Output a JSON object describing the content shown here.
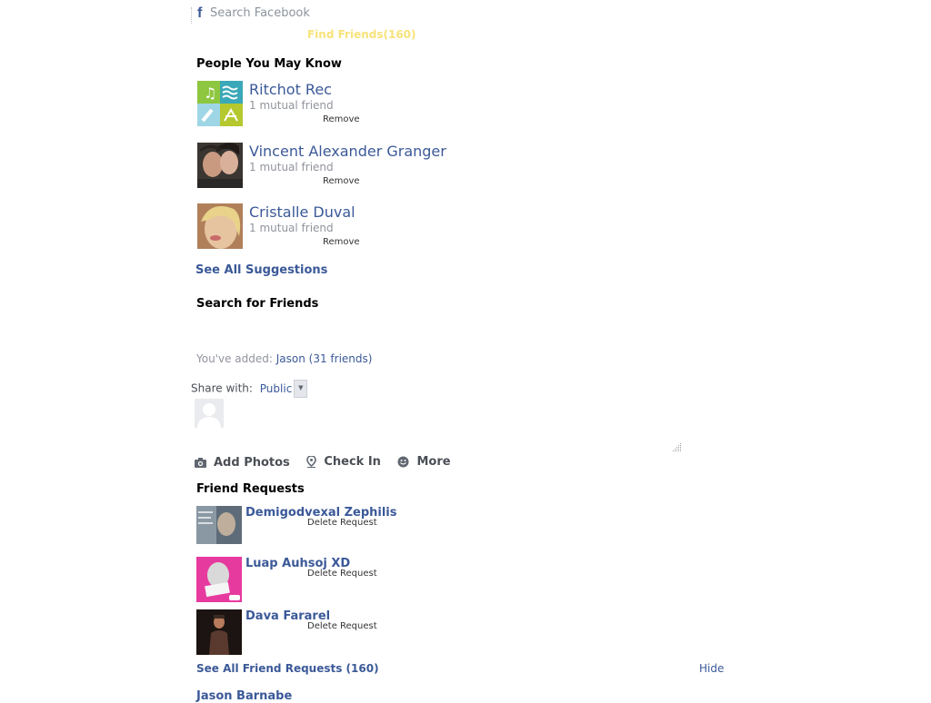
{
  "search": {
    "placeholder": "Search Facebook",
    "logo_icon": "facebook-f-icon"
  },
  "find_friends": {
    "label": "Find Friends",
    "count": "(160)"
  },
  "people_you_may_know": {
    "title": "People You May Know",
    "items": [
      {
        "name": "Ritchot Rec",
        "mutual": "1 mutual friend",
        "remove_label": "Remove"
      },
      {
        "name": "Vincent Alexander Granger",
        "mutual": "1 mutual friend",
        "remove_label": "Remove"
      },
      {
        "name": "Cristalle Duval",
        "mutual": "1 mutual friend",
        "remove_label": "Remove"
      }
    ],
    "see_all_label": "See All Suggestions"
  },
  "search_for_friends": {
    "title": "Search for Friends"
  },
  "added": {
    "prefix": "You've added:",
    "who": "Jason (31 friends)"
  },
  "share": {
    "label": "Share with:",
    "audience": "Public"
  },
  "composer": {
    "actions": [
      {
        "label": "Add Photos",
        "icon": "camera-icon"
      },
      {
        "label": "Check In",
        "icon": "location-pin-icon"
      },
      {
        "label": "More",
        "icon": "smiley-icon"
      }
    ]
  },
  "friend_requests": {
    "title": "Friend Requests",
    "items": [
      {
        "name": "Demigodvexal Zephilis",
        "delete_label": "Delete Request"
      },
      {
        "name": "Luap Auhsoj XD",
        "delete_label": "Delete Request"
      },
      {
        "name": "Dava Fararel",
        "delete_label": "Delete Request"
      }
    ],
    "see_all_label": "See All Friend Requests (160)",
    "hide_label": "Hide",
    "next_name": "Jason Barnabe"
  },
  "colors": {
    "link": "#3b5998",
    "muted": "#90949c",
    "find_friends": "#f7e37a"
  }
}
